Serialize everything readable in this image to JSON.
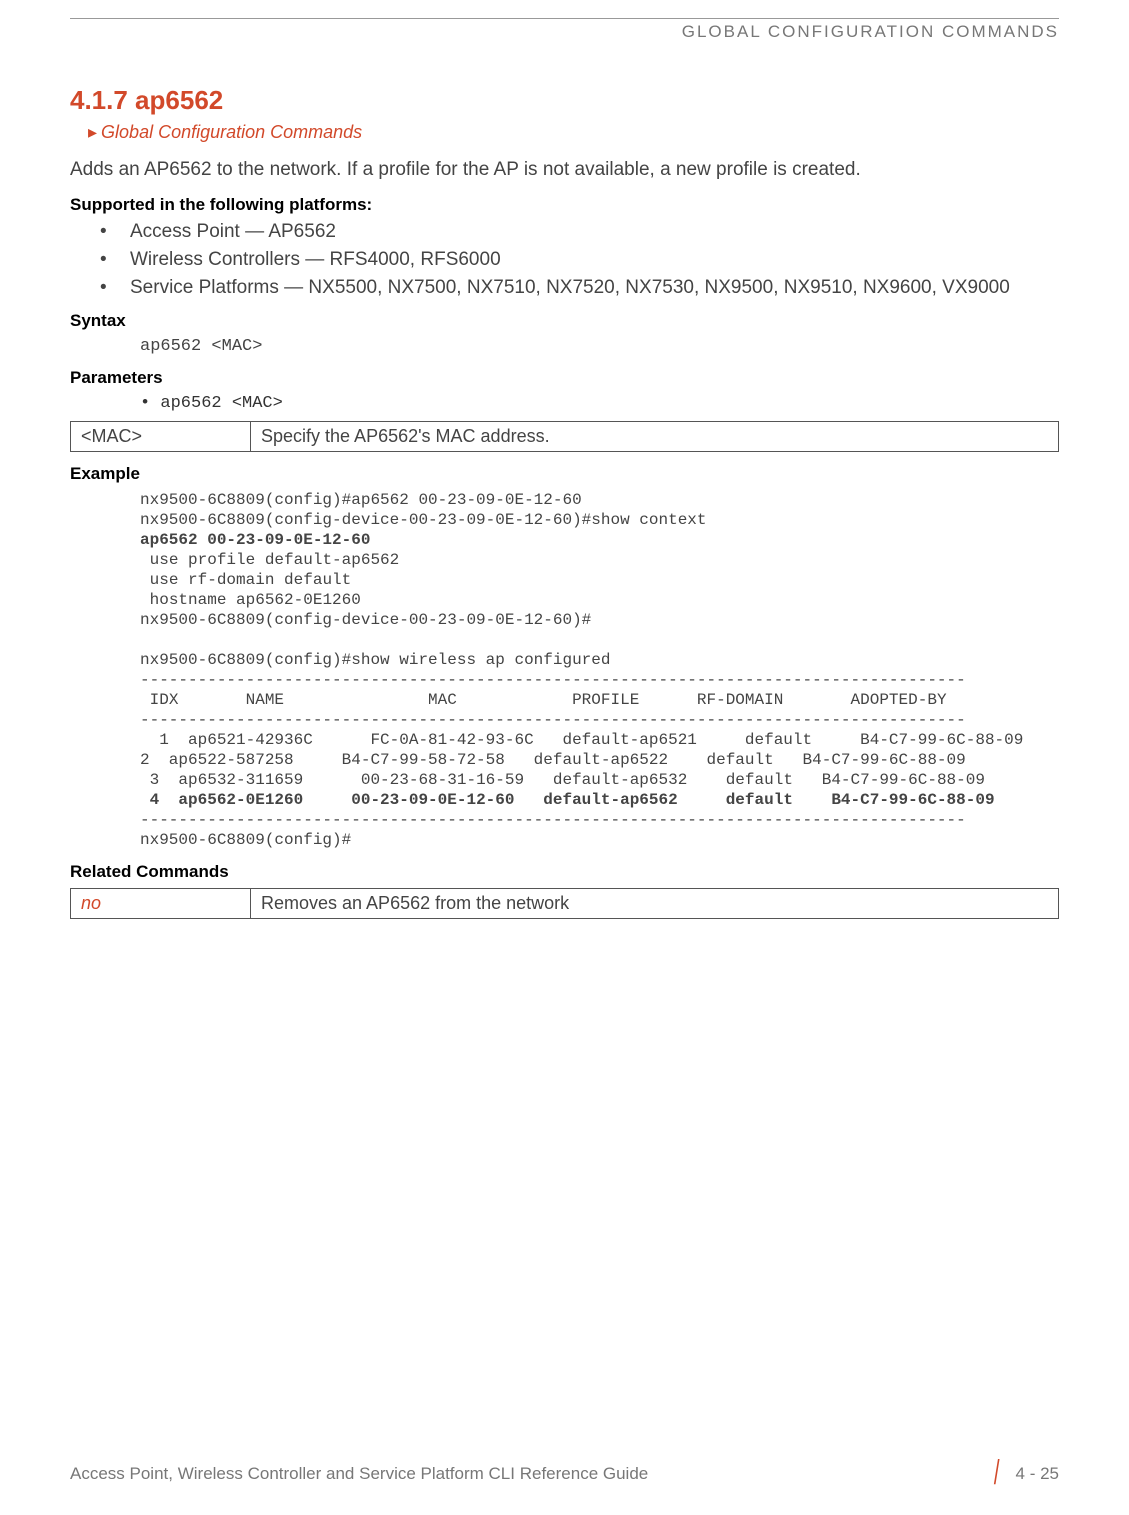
{
  "header": {
    "category": "GLOBAL CONFIGURATION COMMANDS"
  },
  "section": {
    "number_title": "4.1.7 ap6562",
    "breadcrumb": "Global Configuration Commands",
    "intro": "Adds an AP6562 to the network. If a profile for the AP is not available, a new profile is created."
  },
  "supported": {
    "heading": "Supported in the following platforms:",
    "items": [
      "Access Point — AP6562",
      "Wireless Controllers — RFS4000, RFS6000",
      "Service Platforms — NX5500, NX7500, NX7510, NX7520, NX7530, NX9500, NX9510, NX9600, VX9000"
    ]
  },
  "syntax": {
    "heading": "Syntax",
    "code": "ap6562 <MAC>"
  },
  "parameters": {
    "heading": "Parameters",
    "bullet": "• ap6562 <MAC>",
    "rows": [
      {
        "param": "<MAC>",
        "desc": "Specify the AP6562's MAC address."
      }
    ]
  },
  "example": {
    "heading": "Example",
    "line1": "nx9500-6C8809(config)#ap6562 00-23-09-0E-12-60",
    "line2": "nx9500-6C8809(config-device-00-23-09-0E-12-60)#show context",
    "line3_bold": "ap6562 00-23-09-0E-12-60",
    "line4": " use profile default-ap6562",
    "line5": " use rf-domain default",
    "line6": " hostname ap6562-0E1260",
    "line7": "nx9500-6C8809(config-device-00-23-09-0E-12-60)#",
    "blank1": "",
    "line8": "nx9500-6C8809(config)#show wireless ap configured",
    "sep1": "--------------------------------------------------------------------------------------",
    "headers": " IDX       NAME               MAC            PROFILE      RF-DOMAIN       ADOPTED-BY",
    "sep2": "--------------------------------------------------------------------------------------",
    "row1": "  1  ap6521-42936C      FC-0A-81-42-93-6C   default-ap6521     default     B4-C7-99-6C-88-09",
    "row2": "2  ap6522-587258     B4-C7-99-58-72-58   default-ap6522    default   B4-C7-99-6C-88-09",
    "row3": " 3  ap6532-311659      00-23-68-31-16-59   default-ap6532    default   B4-C7-99-6C-88-09",
    "row4_bold": " 4  ap6562-0E1260     00-23-09-0E-12-60   default-ap6562     default    B4-C7-99-6C-88-09",
    "sep3": "--------------------------------------------------------------------------------------",
    "line_end": "nx9500-6C8809(config)#"
  },
  "related": {
    "heading": "Related Commands",
    "rows": [
      {
        "cmd": "no",
        "desc": "Removes an AP6562 from the network"
      }
    ]
  },
  "footer": {
    "left": "Access Point, Wireless Controller and Service Platform CLI Reference Guide",
    "page": "4 - 25"
  }
}
